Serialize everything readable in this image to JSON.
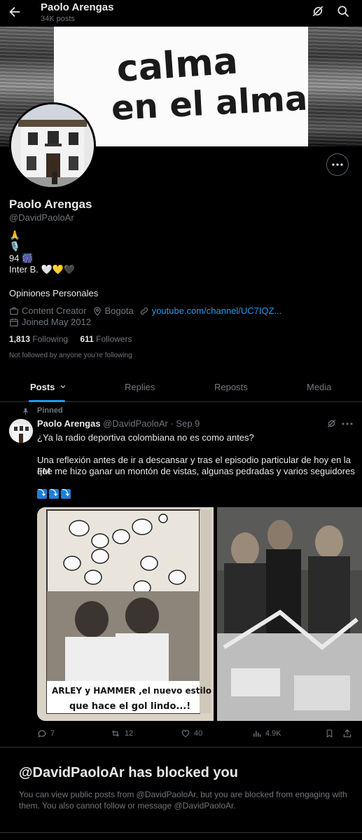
{
  "header": {
    "name": "Paolo Arengas",
    "posts_count": "34K posts"
  },
  "banner": {
    "text_line1": "calma",
    "text_line2": "en el alma."
  },
  "profile": {
    "name": "Paolo Arengas",
    "handle": "@DavidPaoloAr",
    "bio_lines": [
      "🙏",
      "🎙️",
      "94 🎆",
      "Inter B. 🤍💛🖤"
    ],
    "bio_note": "Opiniones Personales",
    "category": "Content Creator",
    "location": "Bogota",
    "website": "youtube.com/channel/UC7IQZ...",
    "joined": "Joined May 2012",
    "following_count": "1,813",
    "following_label": "Following",
    "followers_count": "611",
    "followers_label": "Followers",
    "not_followed": "Not followed by anyone you’re following"
  },
  "tabs": [
    {
      "label": "Posts",
      "active": true
    },
    {
      "label": "Replies",
      "active": false
    },
    {
      "label": "Reposts",
      "active": false
    },
    {
      "label": "Media",
      "active": false
    }
  ],
  "tweet": {
    "pinned_label": "Pinned",
    "author_name": "Paolo Arengas",
    "author_handle": "@DavidPaoloAr",
    "date": "· Sep 9",
    "line1": "¿Ya la radio deportiva colombiana no es como antes?",
    "line2": "Una reflexión antes de ir a descansar y tras el episodio particular de hoy en la FM",
    "line3": "que me hizo ganar un montón de vistas, algunas pedradas y varios seguidores",
    "emoji_arrows": [
      "⤵",
      "⤵",
      "⤵"
    ],
    "image1_caption_line1": "ARLEY y HAMMER ,el nuevo estilo",
    "image1_caption_line2": "que hace el gol lindo...!",
    "replies": "7",
    "reposts": "12",
    "likes": "40",
    "views": "4.9K"
  },
  "blocked": {
    "title": "@DavidPaoloAr has blocked you",
    "text": "You can view public posts from @DavidPaoloAr, but you are blocked from engaging with them. You also cannot follow or message @DavidPaoloAr."
  },
  "colors": {
    "accent": "#1d9bf0",
    "secondary_text": "#71767b",
    "primary_text": "#e7e9ea",
    "border": "#2f3336"
  }
}
